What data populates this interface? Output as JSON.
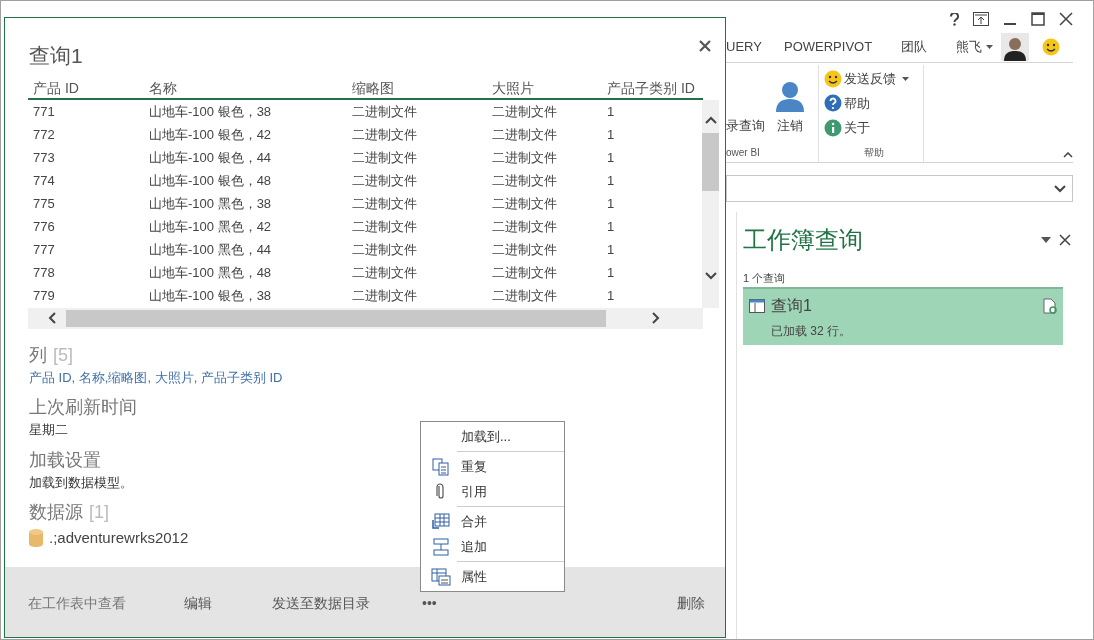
{
  "excel": {
    "tabs": [
      {
        "label": "UERY",
        "selected": false
      },
      {
        "label": "POWERPIVOT",
        "selected": false
      },
      {
        "label": "团队",
        "selected": false
      }
    ],
    "user": {
      "name": "熊飞"
    },
    "ribbon_groups": [
      {
        "label": "ower BI",
        "buttons": [
          {
            "label": "录查询",
            "kind": "cut"
          },
          {
            "label": "注销",
            "kind": "person"
          }
        ]
      },
      {
        "label": "帮助",
        "buttons": [
          {
            "label": "发送反馈",
            "kind": "smiley"
          },
          {
            "label": "帮助",
            "kind": "help"
          },
          {
            "label": "关于",
            "kind": "info"
          }
        ]
      }
    ],
    "pane": {
      "title": "工作簿查询",
      "count": "1 个查询",
      "queries": [
        {
          "name": "查询1",
          "status": "已加载 32 行。",
          "selected": true
        }
      ]
    }
  },
  "popup": {
    "title": "查询1",
    "table": {
      "columns": [
        "产品 ID",
        "名称",
        "缩略图",
        "大照片",
        "产品子类别 ID"
      ],
      "rows": [
        [
          "771",
          "山地车-100 银色，38",
          "二进制文件",
          "二进制文件",
          "1"
        ],
        [
          "772",
          "山地车-100 银色，42",
          "二进制文件",
          "二进制文件",
          "1"
        ],
        [
          "773",
          "山地车-100 银色，44",
          "二进制文件",
          "二进制文件",
          "1"
        ],
        [
          "774",
          "山地车-100 银色，48",
          "二进制文件",
          "二进制文件",
          "1"
        ],
        [
          "775",
          "山地车-100 黑色，38",
          "二进制文件",
          "二进制文件",
          "1"
        ],
        [
          "776",
          "山地车-100 黑色，42",
          "二进制文件",
          "二进制文件",
          "1"
        ],
        [
          "777",
          "山地车-100 黑色，44",
          "二进制文件",
          "二进制文件",
          "1"
        ],
        [
          "778",
          "山地车-100 黑色，48",
          "二进制文件",
          "二进制文件",
          "1"
        ],
        [
          "779",
          "山地车-100 银色，38",
          "二进制文件",
          "二进制文件",
          "1"
        ]
      ]
    },
    "sections": [
      {
        "label": "列",
        "count": "[5]",
        "value": "产品 ID, 名称,缩略图, 大照片, 产品子类别 ID",
        "kind": "link"
      },
      {
        "label": "上次刷新时间",
        "value": "星期二",
        "kind": "text"
      },
      {
        "label": "加载设置",
        "value": "加载到数据模型。",
        "kind": "text"
      },
      {
        "label": "数据源",
        "count": "[1]",
        "value": ".;adventurewrks2012",
        "kind": "database"
      }
    ],
    "actions": [
      "在工作表中查看",
      "编辑",
      "发送至数据目录",
      "•••",
      "删除"
    ],
    "menu": [
      [
        {
          "label": "加载到...",
          "kind": "none"
        }
      ],
      [
        {
          "label": "重复",
          "kind": "copy"
        },
        {
          "label": "引用",
          "kind": "clip"
        }
      ],
      [
        {
          "label": "合并",
          "kind": "merge"
        },
        {
          "label": "追加",
          "kind": "append"
        }
      ],
      [
        {
          "label": "属性",
          "kind": "props"
        }
      ]
    ]
  }
}
